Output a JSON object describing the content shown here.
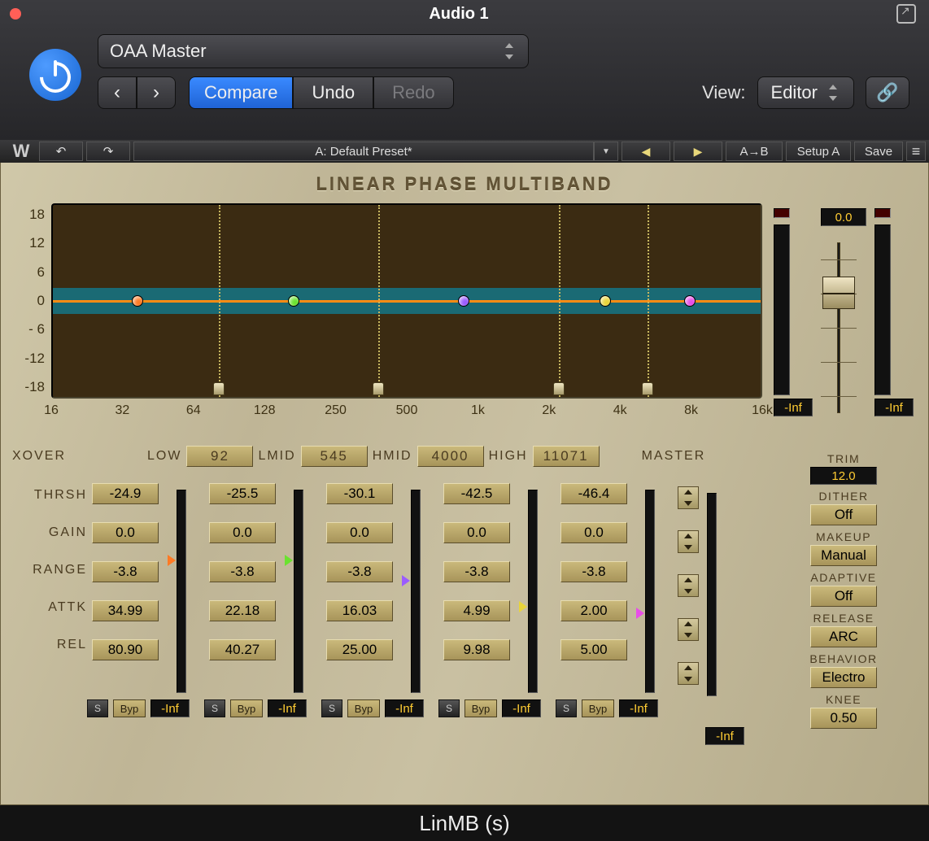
{
  "window_title": "Audio 1",
  "preset_name": "OAA Master",
  "host_buttons": {
    "compare": "Compare",
    "undo": "Undo",
    "redo": "Redo",
    "view_label": "View:",
    "view_value": "Editor"
  },
  "plugbar": {
    "preset": "A: Default Preset*",
    "ab": "A→B",
    "setup": "Setup A",
    "save": "Save",
    "undo_icon": "↶",
    "redo_icon": "↷",
    "arrow_l": "←",
    "arrow_r": "→"
  },
  "plugin_title": "Linear Phase Multiband",
  "db_axis": [
    "18",
    "12",
    "6",
    "0",
    "- 6",
    "-12",
    "-18"
  ],
  "freq_axis": [
    {
      "label": "16",
      "pct": 0
    },
    {
      "label": "32",
      "pct": 10
    },
    {
      "label": "64",
      "pct": 20
    },
    {
      "label": "128",
      "pct": 30
    },
    {
      "label": "250",
      "pct": 40
    },
    {
      "label": "500",
      "pct": 50
    },
    {
      "label": "1k",
      "pct": 60
    },
    {
      "label": "2k",
      "pct": 70
    },
    {
      "label": "4k",
      "pct": 80
    },
    {
      "label": "8k",
      "pct": 90
    },
    {
      "label": "16k",
      "pct": 100
    }
  ],
  "nodes": [
    {
      "pct": 12,
      "color": "#ff7a24"
    },
    {
      "pct": 34,
      "color": "#6ae22f"
    },
    {
      "pct": 58,
      "color": "#9b5bff"
    },
    {
      "pct": 78,
      "color": "#e8d43a"
    },
    {
      "pct": 90,
      "color": "#e84de8"
    }
  ],
  "xover_lines": [
    23.5,
    46,
    71.5,
    84
  ],
  "xover": {
    "label": "Xover",
    "low_label": "Low",
    "lmid_label": "LMid",
    "hmid_label": "HMid",
    "high_label": "High",
    "master_label": "Master",
    "low": "92",
    "lmid": "545",
    "hmid": "4000",
    "high": "11071"
  },
  "row_labels": [
    "Thrsh",
    "Gain",
    "Range",
    "Attk",
    "Rel"
  ],
  "bands": [
    {
      "thr": "-24.9",
      "gain": "0.0",
      "range": "-3.8",
      "attk": "34.99",
      "rel": "80.90",
      "inf": "-Inf",
      "color": "#ff7a24",
      "ptr": 32
    },
    {
      "thr": "-25.5",
      "gain": "0.0",
      "range": "-3.8",
      "attk": "22.18",
      "rel": "40.27",
      "inf": "-Inf",
      "color": "#6ae22f",
      "ptr": 32
    },
    {
      "thr": "-30.1",
      "gain": "0.0",
      "range": "-3.8",
      "attk": "16.03",
      "rel": "25.00",
      "inf": "-Inf",
      "color": "#9b5bff",
      "ptr": 42
    },
    {
      "thr": "-42.5",
      "gain": "0.0",
      "range": "-3.8",
      "attk": "4.99",
      "rel": "9.98",
      "inf": "-Inf",
      "color": "#e8d43a",
      "ptr": 55
    },
    {
      "thr": "-46.4",
      "gain": "0.0",
      "range": "-3.8",
      "attk": "2.00",
      "rel": "5.00",
      "inf": "-Inf",
      "color": "#e84de8",
      "ptr": 58
    }
  ],
  "band_btns": {
    "solo": "S",
    "byp": "Byp"
  },
  "master_inf": "-Inf",
  "side": {
    "gain": "0.0",
    "inf_l": "-Inf",
    "inf_r": "-Inf",
    "trim_label": "Trim",
    "trim": "12.0",
    "dither_label": "Dither",
    "dither": "Off",
    "makeup_label": "Makeup",
    "makeup": "Manual",
    "adaptive_label": "Adaptive",
    "adaptive": "Off",
    "release_label": "Release",
    "release": "ARC",
    "behavior_label": "Behavior",
    "behavior": "Electro",
    "knee_label": "Knee",
    "knee": "0.50"
  },
  "footer": "LinMB (s)"
}
